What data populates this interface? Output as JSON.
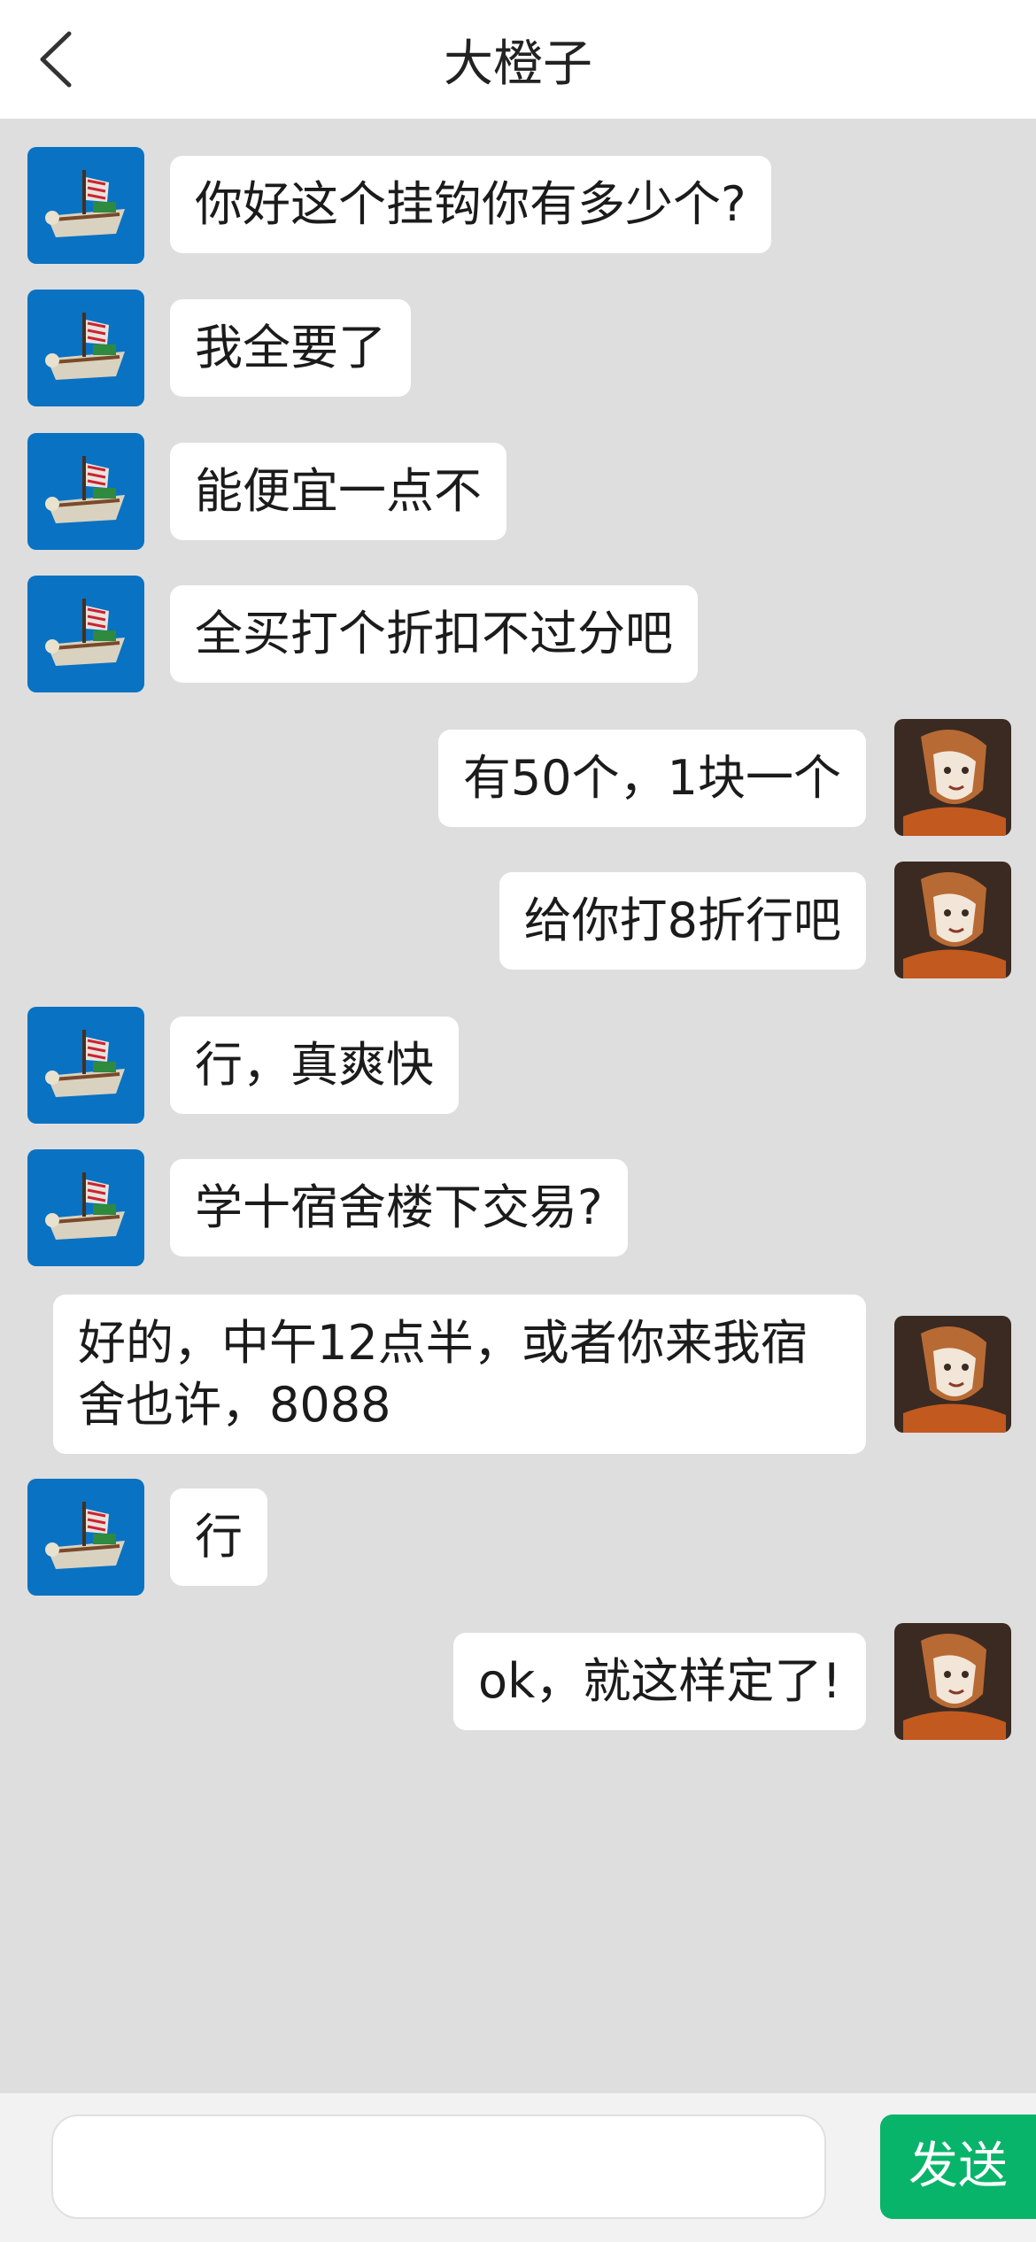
{
  "header": {
    "title": "大橙子"
  },
  "messages": [
    {
      "side": "left",
      "text": "你好这个挂钩你有多少个?"
    },
    {
      "side": "left",
      "text": "我全要了"
    },
    {
      "side": "left",
      "text": "能便宜一点不"
    },
    {
      "side": "left",
      "text": "全买打个折扣不过分吧"
    },
    {
      "side": "right",
      "text": "有50个，1块一个"
    },
    {
      "side": "right",
      "text": "给你打8折行吧"
    },
    {
      "side": "left",
      "text": "行，真爽快"
    },
    {
      "side": "left",
      "text": "学十宿舍楼下交易?"
    },
    {
      "side": "right",
      "text": "好的，中午12点半，或者你来我宿舍也许，8088"
    },
    {
      "side": "left",
      "text": "行"
    },
    {
      "side": "right",
      "text": "ok，就这样定了!"
    }
  ],
  "footer": {
    "input_value": "",
    "send_label": "发送"
  },
  "colors": {
    "background": "#dedede",
    "bubble": "#ffffff",
    "send_button": "#08b46a",
    "left_avatar_bg": "#0a72c2",
    "right_avatar_bg": "#3a2a22"
  },
  "icons": {
    "back": "chevron-left-icon",
    "left_avatar": "pirate-ship-avatar",
    "right_avatar": "anime-girl-avatar"
  }
}
